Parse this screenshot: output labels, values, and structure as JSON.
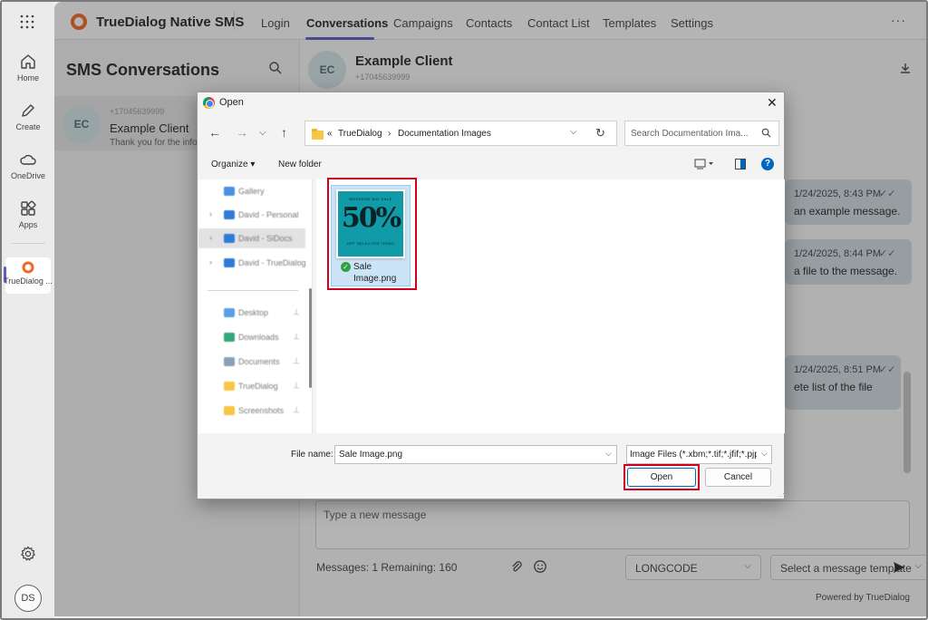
{
  "rail": {
    "items": [
      {
        "label": "Home",
        "icon": "home-icon"
      },
      {
        "label": "Create",
        "icon": "pen-icon"
      },
      {
        "label": "OneDrive",
        "icon": "cloud-icon"
      },
      {
        "label": "Apps",
        "icon": "apps-icon"
      },
      {
        "label": "TrueDialog ...",
        "icon": "truedialog-icon"
      }
    ],
    "avatar": "DS"
  },
  "header": {
    "brand": "TrueDialog Native SMS",
    "nav": [
      "Login",
      "Conversations",
      "Campaigns",
      "Contacts",
      "Contact List",
      "Templates",
      "Settings"
    ],
    "active_tab": "Conversations",
    "more": "···"
  },
  "list": {
    "title": "SMS Conversations",
    "item": {
      "initials": "EC",
      "number": "+17045639999",
      "name": "Example Client",
      "preview": "Thank you for the info"
    }
  },
  "chat": {
    "initials": "EC",
    "title": "Example Client",
    "number": "+17045639999",
    "messages": [
      {
        "timestamp": "1/24/2025, 8:43 PM",
        "text": "an example message.",
        "check": "✓✓"
      },
      {
        "timestamp": "1/24/2025, 8:44 PM",
        "text": "a file to the message.",
        "check": "✓✓"
      },
      {
        "timestamp": "1/24/2025, 8:51 PM",
        "text": "ete list of the file",
        "check": "✓✓"
      }
    ],
    "composer_placeholder": "Type a new message",
    "counter": "Messages: 1 Remaining: 160",
    "sender_select": "LONGCODE",
    "template_select": "Select a message template",
    "powered_by": "Powered by TrueDialog"
  },
  "dialog": {
    "title": "Open",
    "path": {
      "root": "«",
      "parts": [
        "TrueDialog",
        "Documentation Images"
      ],
      "separator": "›"
    },
    "search_placeholder": "Search Documentation Ima...",
    "toolbar": {
      "organize": "Organize ▾",
      "new_folder": "New folder"
    },
    "sidebar": [
      {
        "label": "Gallery",
        "color": "#4a8fe0",
        "chev": "",
        "pin": ""
      },
      {
        "label": "David - Personal",
        "color": "#2f7bd6",
        "chev": "›",
        "pin": ""
      },
      {
        "label": "David - SiDocs",
        "color": "#2f7bd6",
        "chev": "›",
        "pin": "",
        "selected": true
      },
      {
        "label": "David - TrueDialog",
        "color": "#2f7bd6",
        "chev": "›",
        "pin": ""
      },
      {
        "label": "Desktop",
        "color": "#5aa0e8",
        "chev": "",
        "pin": "📌"
      },
      {
        "label": "Downloads",
        "color": "#34a87a",
        "chev": "",
        "pin": "📌"
      },
      {
        "label": "Documents",
        "color": "#8aa0b8",
        "chev": "",
        "pin": "📌"
      },
      {
        "label": "TrueDialog",
        "color": "#f6c744",
        "chev": "",
        "pin": "📌"
      },
      {
        "label": "Screenshots",
        "color": "#f6c744",
        "chev": "",
        "pin": "📌"
      }
    ],
    "file": {
      "name": "Sale Image.png",
      "thumb_top": "WEEKEND BIG SALE",
      "thumb_big": "50%",
      "thumb_bottom": "OFF SELECTED ITEMS"
    },
    "filename_label": "File name:",
    "filename_value": "Sale Image.png",
    "filetype": "Image Files (*.xbm;*.tif;*.jfif;*.pjp",
    "open_label": "Open",
    "cancel_label": "Cancel"
  }
}
